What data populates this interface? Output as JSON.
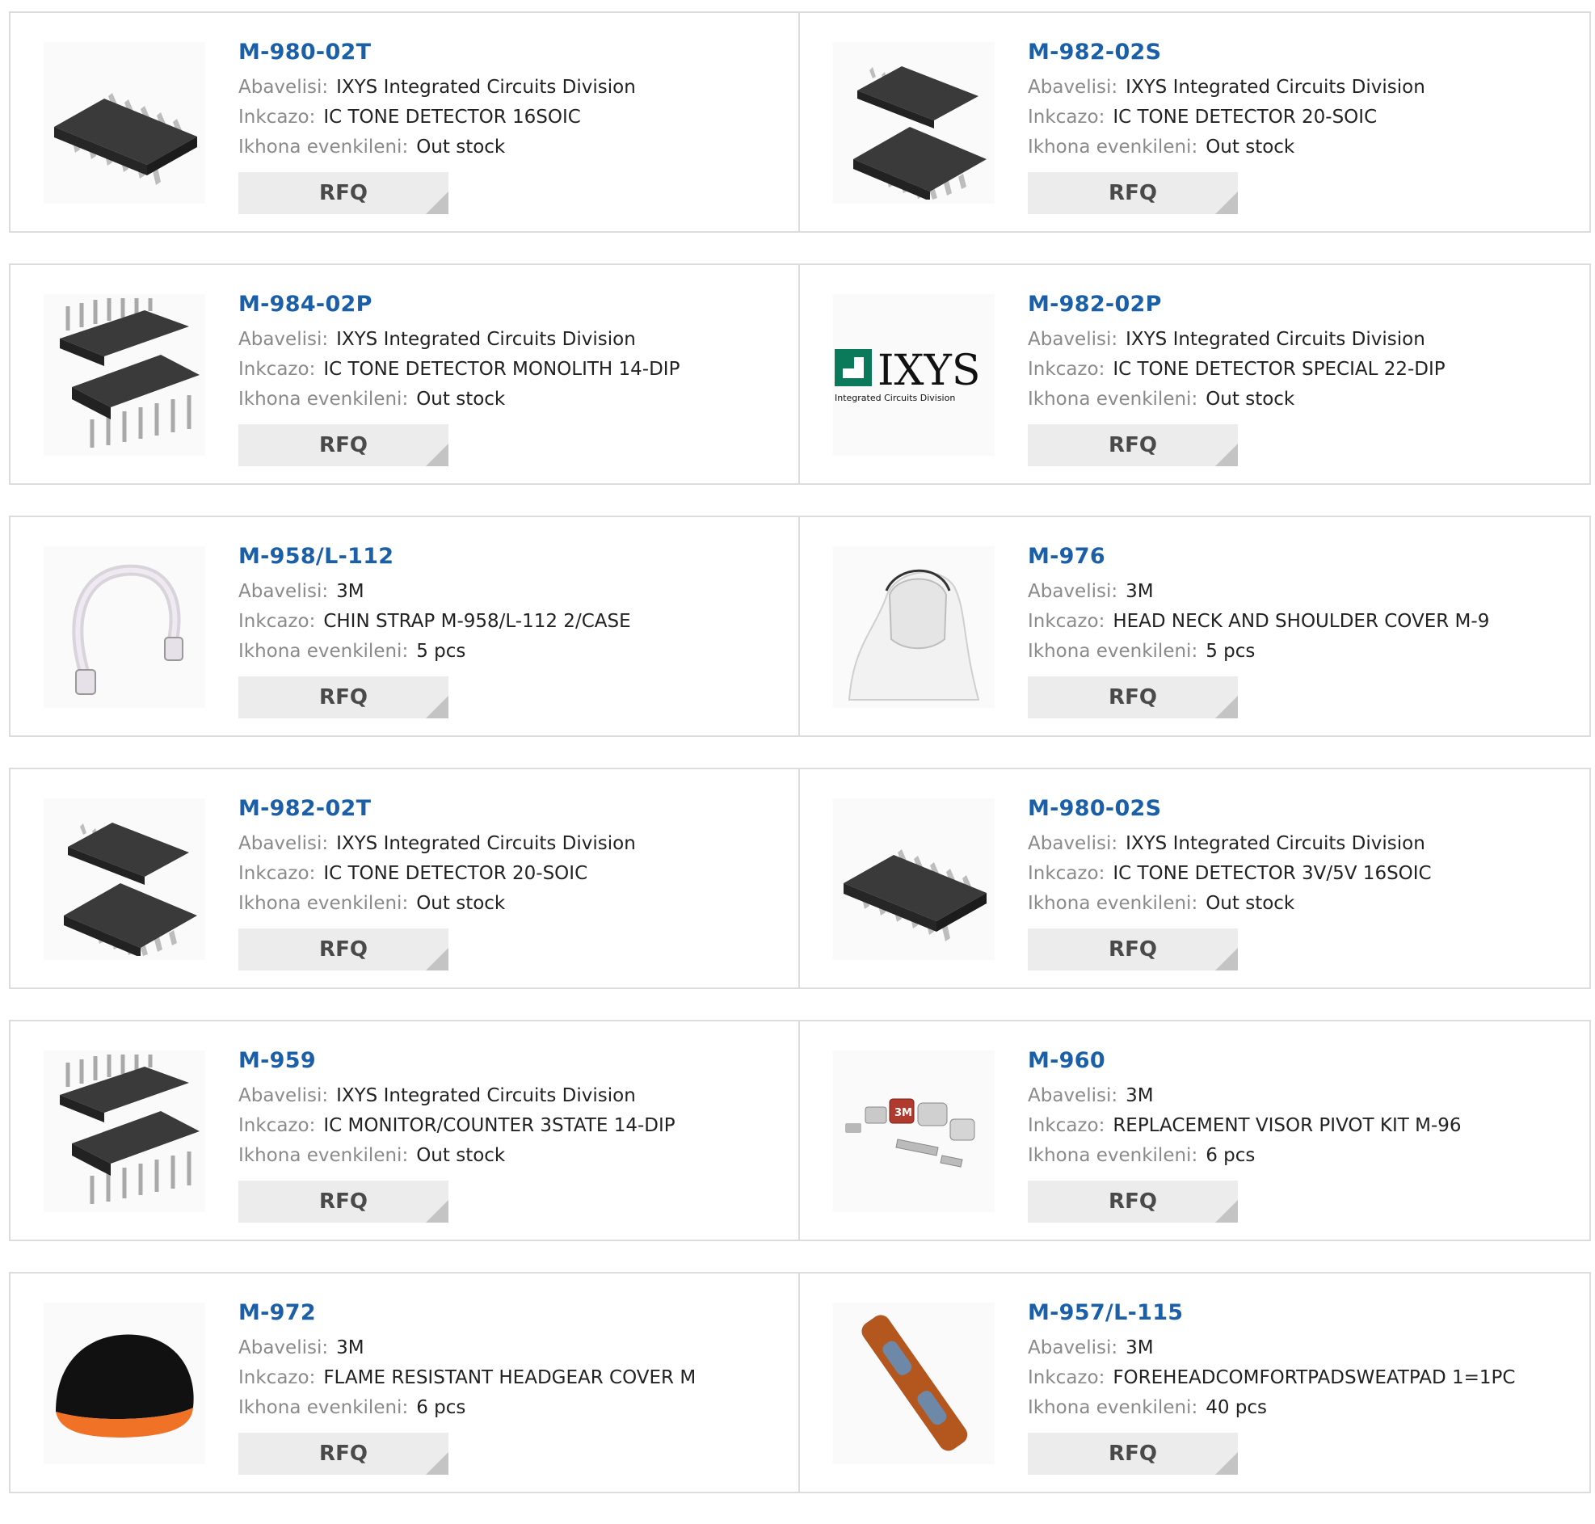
{
  "labels": {
    "manufacturer": "Abavelisi:",
    "description": "Inkcazo:",
    "stock": "Ikhona evenkileni:",
    "rfq": "RFQ"
  },
  "products": [
    {
      "part": "M-980-02T",
      "manufacturer": "IXYS Integrated Circuits Division",
      "description": "IC TONE DETECTOR 16SOIC",
      "stock": "Out stock",
      "image": "soic-chip"
    },
    {
      "part": "M-982-02S",
      "manufacturer": "IXYS Integrated Circuits Division",
      "description": "IC TONE DETECTOR 20-SOIC",
      "stock": "Out stock",
      "image": "soic-pair"
    },
    {
      "part": "M-984-02P",
      "manufacturer": "IXYS Integrated Circuits Division",
      "description": "IC TONE DETECTOR MONOLITH 14-DIP",
      "stock": "Out stock",
      "image": "dip-pair"
    },
    {
      "part": "M-982-02P",
      "manufacturer": "IXYS Integrated Circuits Division",
      "description": "IC TONE DETECTOR SPECIAL 22-DIP",
      "stock": "Out stock",
      "image": "ixys-logo",
      "logo_text": "IXYS",
      "logo_subtext": "Integrated Circuits Division"
    },
    {
      "part": "M-958/L-112",
      "manufacturer": "3M",
      "description": "CHIN STRAP M-958/L-112 2/CASE",
      "stock": "5 pcs",
      "image": "chin-strap"
    },
    {
      "part": "M-976",
      "manufacturer": "3M",
      "description": "HEAD NECK AND SHOULDER COVER M-9",
      "stock": "5 pcs",
      "image": "hood"
    },
    {
      "part": "M-982-02T",
      "manufacturer": "IXYS Integrated Circuits Division",
      "description": "IC TONE DETECTOR 20-SOIC",
      "stock": "Out stock",
      "image": "soic-pair"
    },
    {
      "part": "M-980-02S",
      "manufacturer": "IXYS Integrated Circuits Division",
      "description": "IC TONE DETECTOR 3V/5V 16SOIC",
      "stock": "Out stock",
      "image": "soic-chip"
    },
    {
      "part": "M-959",
      "manufacturer": "IXYS Integrated Circuits Division",
      "description": "IC MONITOR/COUNTER 3STATE 14-DIP",
      "stock": "Out stock",
      "image": "dip-pair"
    },
    {
      "part": "M-960",
      "manufacturer": "3M",
      "description": "REPLACEMENT VISOR PIVOT KIT M-96",
      "stock": "6 pcs",
      "image": "pivot-kit",
      "logo_text": "3M"
    },
    {
      "part": "M-972",
      "manufacturer": "3M",
      "description": "FLAME RESISTANT HEADGEAR COVER M",
      "stock": "6 pcs",
      "image": "headgear-cover"
    },
    {
      "part": "M-957/L-115",
      "manufacturer": "3M",
      "description": "FOREHEADCOMFORTPADSWEATPAD 1=1PC",
      "stock": "40 pcs",
      "image": "sweatpad"
    }
  ]
}
